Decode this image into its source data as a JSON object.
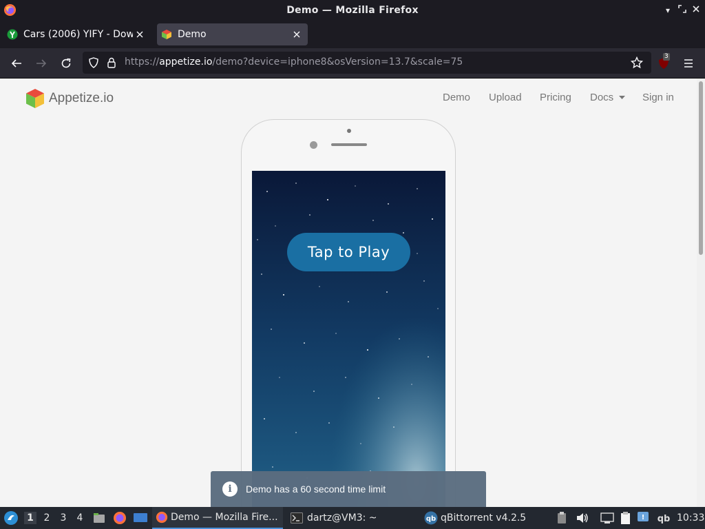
{
  "window": {
    "title": "Demo — Mozilla Firefox"
  },
  "tabs": [
    {
      "label": "Cars (2006) YIFY - Download",
      "active": false,
      "icon": "yify-favicon"
    },
    {
      "label": "Demo",
      "active": true,
      "icon": "appetize-favicon"
    }
  ],
  "navbar": {
    "url_prefix": "https://",
    "url_host": "appetize.io",
    "url_path": "/demo?device=iphone8&osVersion=13.7&scale=75",
    "ublock_badge": "3"
  },
  "site": {
    "brand": "Appetize.io",
    "nav": [
      "Demo",
      "Upload",
      "Pricing",
      "Docs",
      "Sign in"
    ]
  },
  "phone": {
    "play_label": "Tap to Play"
  },
  "toast": {
    "message": "Demo has a 60 second time limit"
  },
  "taskbar": {
    "workspaces": [
      "1",
      "2",
      "3",
      "4"
    ],
    "tasks": [
      {
        "label": "Demo — Mozilla Fire...",
        "icon": "firefox-icon",
        "active": true
      },
      {
        "label": "dartz@VM3: ~",
        "icon": "terminal-icon",
        "active": false
      },
      {
        "label": "qBittorrent v4.2.5",
        "icon": "qbittorrent-icon",
        "active": false
      }
    ],
    "clock": "10:33"
  },
  "colors": {
    "browser_chrome": "#1c1b22",
    "toolbar": "#2b2a33",
    "active_tab": "#42414d",
    "play_button": "#1a6fa3",
    "toast": "#5b6d80",
    "taskbar": "#232830"
  }
}
